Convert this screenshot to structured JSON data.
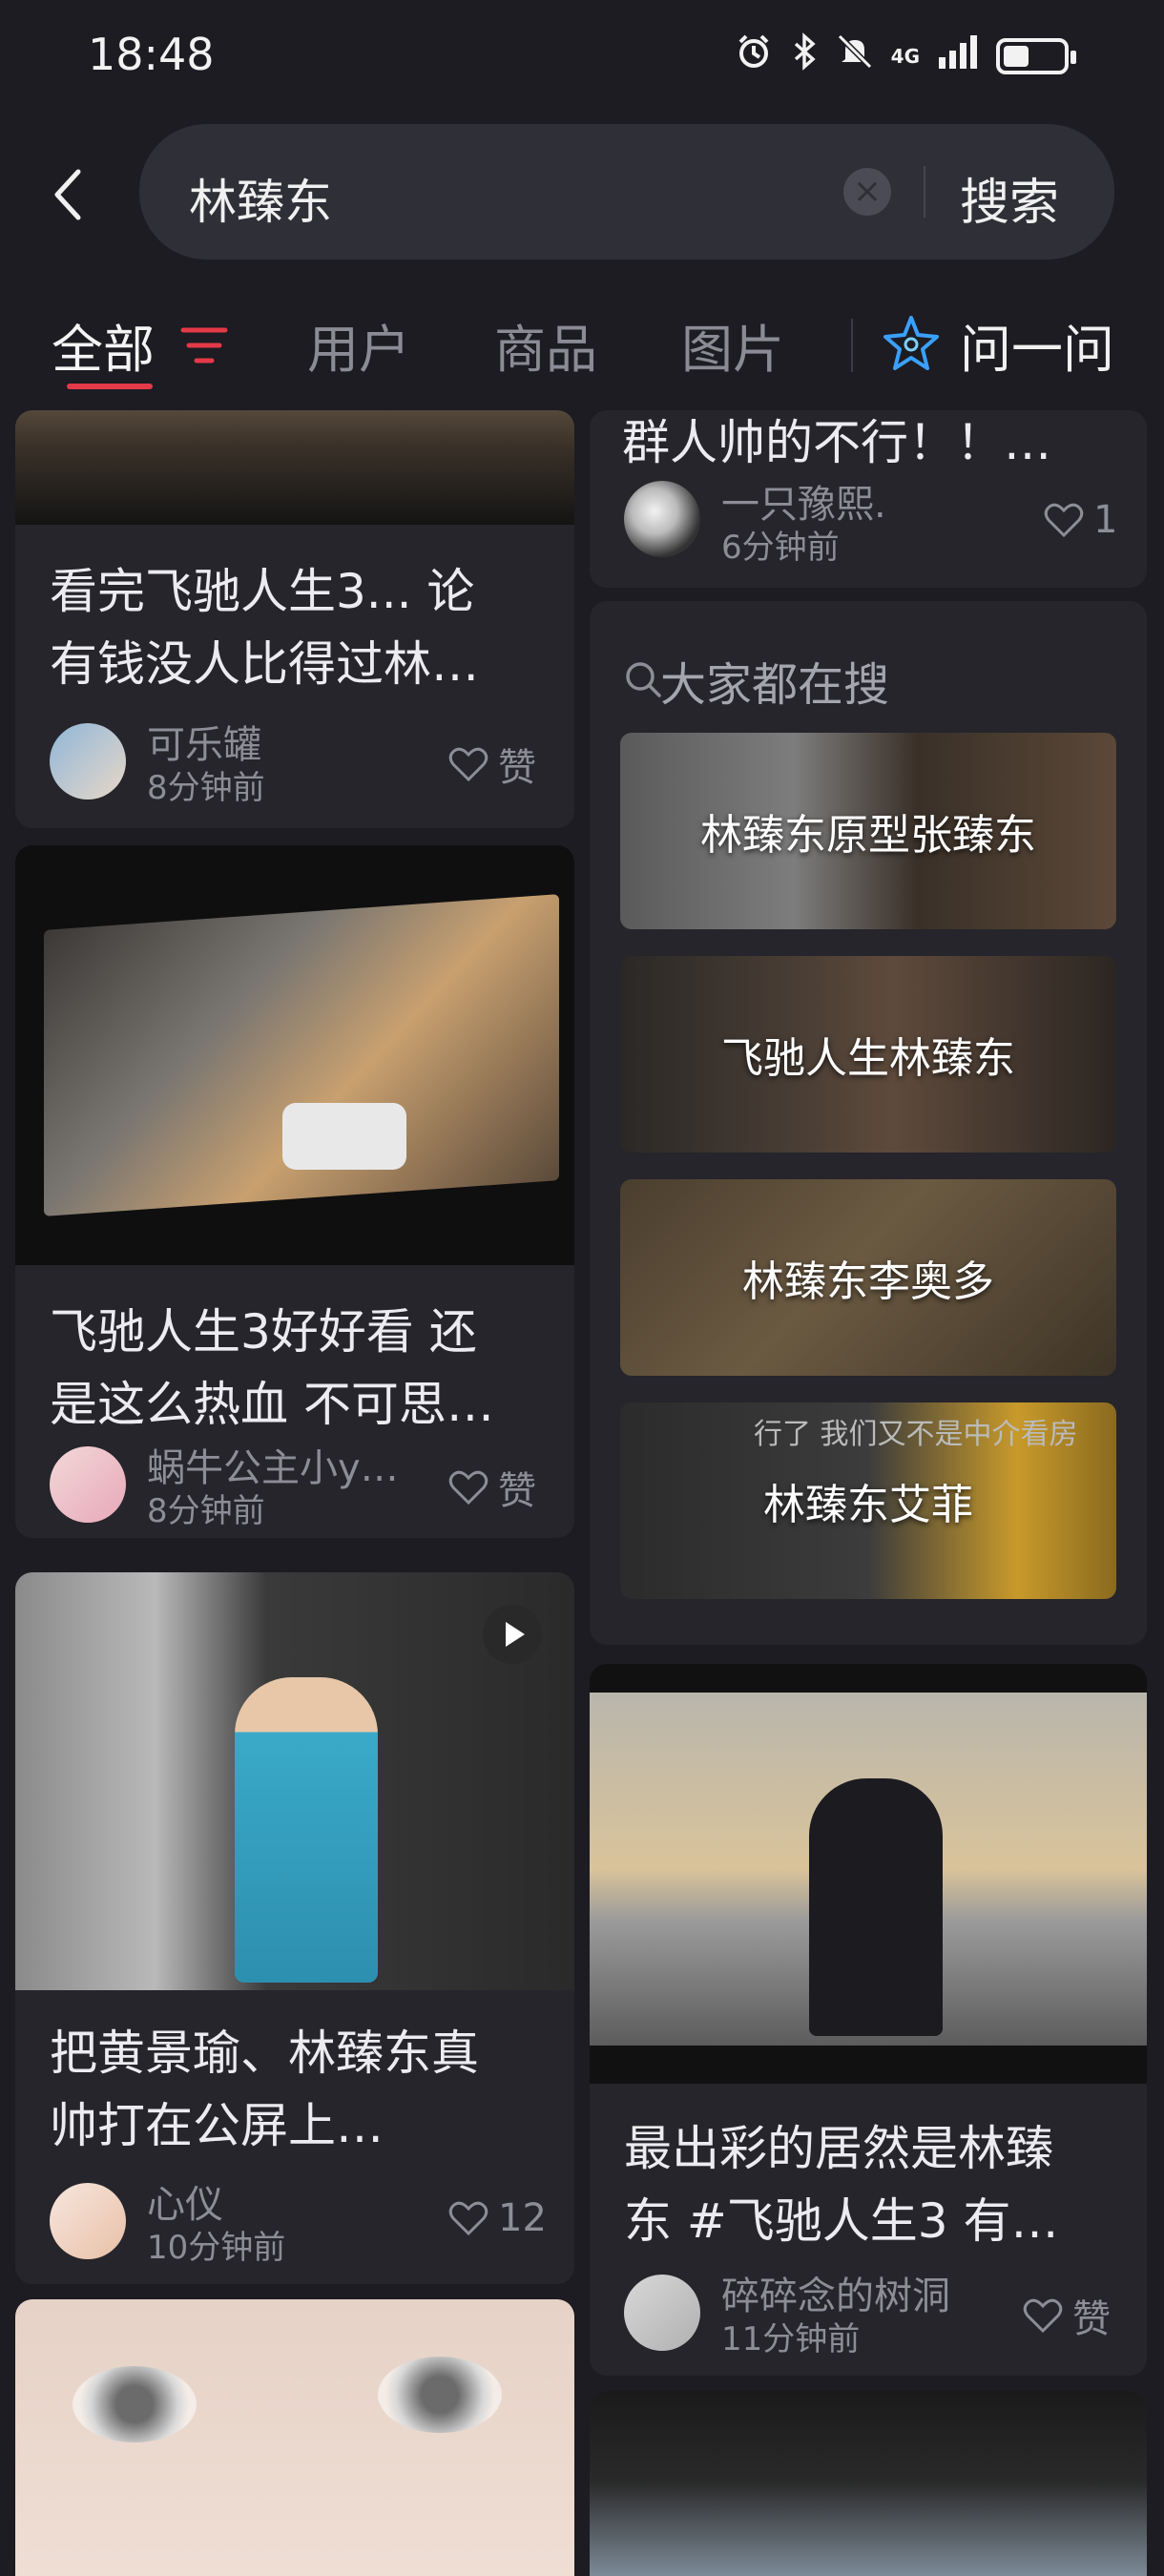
{
  "status_bar": {
    "time": "18:48",
    "network": "4G",
    "colors": {
      "accent": "#e53948"
    }
  },
  "search": {
    "query": "林臻东",
    "button": "搜索"
  },
  "tabs": {
    "items": [
      "全部",
      "用户",
      "商品",
      "图片"
    ],
    "ask": "问一问"
  },
  "feed": {
    "partial_left": {
      "title_lines": [
        "看完飞驰人生3... 论",
        "有钱没人比得过林…"
      ],
      "user": "可乐罐",
      "time": "8分钟前",
      "likes": "赞"
    },
    "partial_right": {
      "title_line": "群人帅的不行！！…",
      "user": "一只豫熙.",
      "time": "6分钟前",
      "likes": "1"
    },
    "card_theater": {
      "title_lines": [
        "飞驰人生3好好看 还",
        "是这么热血 不可思…"
      ],
      "user": "蜗牛公主小y…",
      "time": "8分钟前",
      "likes": "赞"
    },
    "card_video": {
      "title_lines": [
        "把黄景瑜、林臻东真",
        "帅打在公屏上…"
      ],
      "user": "心仪",
      "time": "10分钟前",
      "likes": "12"
    },
    "card_screen": {
      "title_lines": [
        "最出彩的居然是林臻",
        "东 #飞驰人生3  有…"
      ],
      "user": "碎碎念的树洞",
      "time": "11分钟前",
      "likes": "赞"
    },
    "hot_search": {
      "title": "大家都在搜",
      "items": [
        "林臻东原型张臻东",
        "飞驰人生林臻东",
        "林臻东李奥多",
        "林臻东艾菲"
      ],
      "subtitle_overlay": "行了 我们又不是中介看房"
    }
  }
}
